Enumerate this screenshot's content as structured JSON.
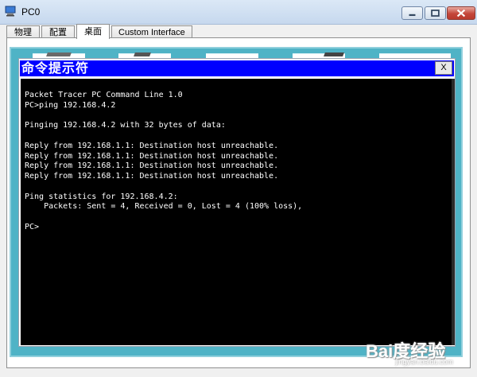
{
  "window": {
    "title": "PC0",
    "icon": "computer-icon",
    "controls": [
      "minimize-icon",
      "maximize-icon",
      "close-icon"
    ]
  },
  "tabs": [
    {
      "label": "物理",
      "active": false
    },
    {
      "label": "配置",
      "active": false
    },
    {
      "label": "桌面",
      "active": true
    },
    {
      "label": "Custom Interface",
      "active": false
    }
  ],
  "command_prompt": {
    "title": "命令提示符",
    "close_label": "X",
    "lines": [
      "Packet Tracer PC Command Line 1.0",
      "PC>ping 192.168.4.2",
      "",
      "Pinging 192.168.4.2 with 32 bytes of data:",
      "",
      "Reply from 192.168.1.1: Destination host unreachable.",
      "Reply from 192.168.1.1: Destination host unreachable.",
      "Reply from 192.168.1.1: Destination host unreachable.",
      "Reply from 192.168.1.1: Destination host unreachable.",
      "",
      "Ping statistics for 192.168.4.2:",
      "    Packets: Sent = 4, Received = 0, Lost = 4 (100% loss),",
      "",
      "PC>"
    ]
  },
  "watermark": {
    "text": "Bai度经验",
    "sub": "jingyan.baidu.com"
  },
  "colors": {
    "desktop": "#4fb3c6",
    "cmd_title_bar": "#0000ff",
    "terminal_bg": "#000000",
    "terminal_text": "#ffffff"
  }
}
